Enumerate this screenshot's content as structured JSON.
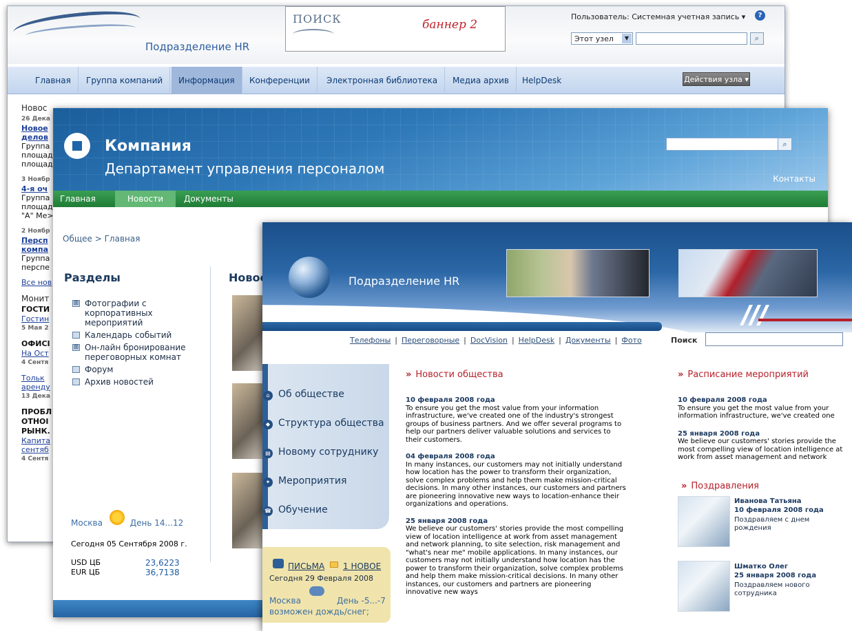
{
  "win1": {
    "site_title": "Подразделение HR",
    "banner_word": "ПОИСК",
    "banner_text": "баннер 2",
    "user": "Пользователь: Системная учетная запись ▾",
    "scope": "Этот узел",
    "nav": [
      "Главная",
      "Группа компаний",
      "Информация",
      "Конференции",
      "Электронная библиотека",
      "Медиа архив",
      "HelpDesk"
    ],
    "actions": "Действия узла ▾",
    "left_fragments": [
      {
        "t": "Новос",
        "s": "h"
      },
      {
        "t": "26 Дека",
        "s": "d"
      },
      {
        "t": "Новое",
        "s": "l"
      },
      {
        "t": "делов",
        "s": "l"
      },
      {
        "t": "Группа",
        "s": "p"
      },
      {
        "t": "площад",
        "s": "p"
      },
      {
        "t": "площад",
        "s": "p"
      },
      {
        "t": "",
        "s": "gap"
      },
      {
        "t": "3 Ноябр",
        "s": "d"
      },
      {
        "t": "4-я оч",
        "s": "l"
      },
      {
        "t": "Группа",
        "s": "p"
      },
      {
        "t": "площад",
        "s": "p"
      },
      {
        "t": "\"А\" Ме>",
        "s": "p"
      },
      {
        "t": "",
        "s": "gap"
      },
      {
        "t": "2 Ноябр",
        "s": "d"
      },
      {
        "t": "Персп",
        "s": "l"
      },
      {
        "t": "компа",
        "s": "l"
      },
      {
        "t": "Группа",
        "s": "p"
      },
      {
        "t": "перспе",
        "s": "p"
      },
      {
        "t": "",
        "s": "gap"
      },
      {
        "t": "Все нов",
        "s": "a"
      },
      {
        "t": "",
        "s": "gap"
      },
      {
        "t": "Монит",
        "s": "h"
      },
      {
        "t": "ГОСТИ",
        "s": "b"
      },
      {
        "t": "Гостин",
        "s": "a"
      },
      {
        "t": "5 Мая 2",
        "s": "d"
      },
      {
        "t": "",
        "s": "gap"
      },
      {
        "t": "ОФИСІ",
        "s": "b"
      },
      {
        "t": "На Ост",
        "s": "a"
      },
      {
        "t": "4 Сентя",
        "s": "d"
      },
      {
        "t": "",
        "s": "gap"
      },
      {
        "t": "Тольк",
        "s": "a"
      },
      {
        "t": "аренду",
        "s": "a"
      },
      {
        "t": "13 Дека",
        "s": "d"
      },
      {
        "t": "",
        "s": "gap"
      },
      {
        "t": "ПРОБЛ",
        "s": "b"
      },
      {
        "t": "ОТНОІ",
        "s": "b"
      },
      {
        "t": "РЫНК.",
        "s": "b"
      },
      {
        "t": "Капита",
        "s": "a"
      },
      {
        "t": "сентяб",
        "s": "a"
      },
      {
        "t": "4 Сентя",
        "s": "d"
      }
    ]
  },
  "win2": {
    "brand": "Компания",
    "department": "Департамент управления персоналом",
    "nav": [
      "Главная",
      "Новости",
      "Документы"
    ],
    "contacts": "Контакты",
    "breadcrumb": "Общее > Главная",
    "sections_title": "Разделы",
    "sections": [
      {
        "icon": "⊞",
        "label": "Фотографии с корпоративных мероприятий"
      },
      {
        "icon": "",
        "label": "Календарь событий"
      },
      {
        "icon": "⊞",
        "label": "Он-лайн бронирование переговорных комнат"
      },
      {
        "icon": "",
        "label": "Форум"
      },
      {
        "icon": "",
        "label": "Архив новостей"
      }
    ],
    "news_title": "Новос",
    "weather_city": "Москва",
    "weather_day": "День 14...12",
    "today": "Сегодня 05 Сентября 2008 г.",
    "currencies": [
      {
        "name": "USD ЦБ",
        "value": "23,6223"
      },
      {
        "name": "EUR ЦБ",
        "value": "36,7138"
      }
    ]
  },
  "win3": {
    "site_name": "Подразделение HR",
    "top_links": [
      "Телефоны",
      "Переговорные",
      "DocVision",
      "HelpDesk",
      "Документы",
      "Фото"
    ],
    "search_label": "Поиск",
    "menu": [
      {
        "icon": "home",
        "label": "Об обществе"
      },
      {
        "icon": "diamond",
        "label": "Структура общества"
      },
      {
        "icon": "doc",
        "label": "Новому сотруднику"
      },
      {
        "icon": "event",
        "label": "Мероприятия"
      },
      {
        "icon": "phone",
        "label": "Обучение"
      }
    ],
    "mail": {
      "letters": "ПИСЬМА",
      "new": "1 НОВОЕ",
      "date": "Сегодня 29 Февраля 2008",
      "city": "Москва",
      "day": "День -5...-7",
      "forecast": "возможен дождь/снег;"
    },
    "news_title": "Новости общества",
    "news": [
      {
        "date": "10 февраля 2008 года",
        "text": "To ensure you get the most value from your information infrastructure, we've created one of the industry's strongest groups of business partners. And we offer several programs to help our partners deliver valuable solutions and services to their customers."
      },
      {
        "date": "04 февраля 2008 года",
        "text": "In many instances, our customers may not initially understand how location has the power to transform their organization, solve complex problems and help them make mission-critical decisions. In many other instances, our customers and partners are pioneering innovative new ways to location-enhance their organizations and operations."
      },
      {
        "date": "25 января 2008 года",
        "text": "We believe our customers' stories provide the most compelling view of location intelligence at work from asset management and network planning, to site selection, risk management and \"what's near me\" mobile applications. In many instances, our customers may not initially understand how location has the power to transform their organization, solve complex problems and help them make mission-critical decisions. In many other instances, our customers and partners are pioneering innovative new ways"
      }
    ],
    "schedule_title": "Расписание мероприятий",
    "schedule": [
      {
        "date": "10 февраля 2008 года",
        "text": "To ensure you get the most value from your information infrastructure, we've created one"
      },
      {
        "date": "25 января 2008 года",
        "text": "We believe our customers' stories provide the most compelling view of location intelligence at work from asset management and network"
      }
    ],
    "congrats_title": "Поздравления",
    "congrats": [
      {
        "name": "Иванова Татьяна",
        "date": "10 февраля 2008 года",
        "text": "Поздравляем с днем рождения"
      },
      {
        "name": "Шматко Олег",
        "date": "25 января 2008 года",
        "text": "Поздравляем нового сотрудника"
      }
    ]
  }
}
